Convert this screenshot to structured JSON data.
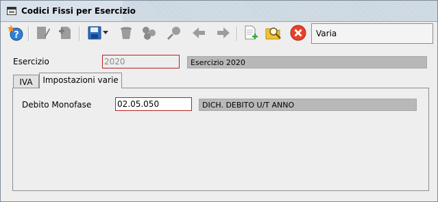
{
  "window": {
    "title": "Codici Fissi per Esercizio"
  },
  "toolbar": {
    "buttons": [
      {
        "icon": "help-star-icon",
        "enabled": true
      },
      {
        "icon": "edit-document-icon",
        "enabled": false
      },
      {
        "icon": "new-document-icon",
        "enabled": false
      },
      {
        "icon": "save-icon",
        "enabled": true
      },
      {
        "icon": "dropdown-arrow-icon",
        "enabled": true
      },
      {
        "icon": "trash-icon",
        "enabled": false
      },
      {
        "icon": "link-icon",
        "enabled": false
      },
      {
        "icon": "search-magnifier-icon",
        "enabled": false
      },
      {
        "icon": "arrow-left-icon",
        "enabled": false
      },
      {
        "icon": "arrow-right-icon",
        "enabled": false
      },
      {
        "icon": "add-document-icon",
        "enabled": true
      },
      {
        "icon": "search-folder-icon",
        "enabled": true
      },
      {
        "icon": "close-icon",
        "enabled": true
      }
    ],
    "mode_label": "Varia"
  },
  "form": {
    "esercizio_label": "Esercizio",
    "esercizio_value": "2020",
    "esercizio_description": "Esercizio 2020"
  },
  "tabs": [
    {
      "label": "IVA",
      "active": false
    },
    {
      "label": "Impostazioni varie",
      "active": true
    }
  ],
  "settings": {
    "debito_label": "Debito Monofase",
    "debito_value": "02.05.050",
    "debito_description": "DICH. DEBITO U/T ANNO"
  },
  "colors": {
    "accent_red": "#b22222",
    "title_bar": "#d9e2ea",
    "description_bg": "#b8b8b8"
  }
}
